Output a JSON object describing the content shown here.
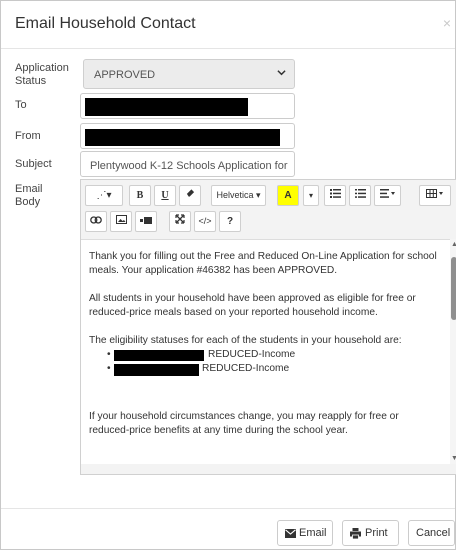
{
  "dialog": {
    "title": "Email Household Contact",
    "close_glyph": "×"
  },
  "form": {
    "status_label": "Application Status",
    "status_label_line1": "Application",
    "status_label_line2": "Status",
    "status_value": "APPROVED",
    "to_label": "To",
    "from_label": "From",
    "subject_label": "Subject",
    "subject_value": "Plentywood K-12 Schools Application for",
    "body_label_line1": "Email",
    "body_label_line2": "Body"
  },
  "toolbar": {
    "row1": {
      "magic_label": "⋰▾",
      "bold_label": "B",
      "underline_label": "U",
      "eraser_label": "⌫",
      "font_label": "Helvetica ▾",
      "color_label": "A",
      "color_caret": "▾",
      "ul_label": "☰",
      "ol_label": "☷",
      "align_label": "≡ ▾",
      "table_label": "⊞ ▾"
    },
    "row2": {
      "link_label": "⊖",
      "image_label": "▣",
      "video_label": "▪▬",
      "fullscreen_label": "✕",
      "code_label": "</>",
      "help_label": "?"
    }
  },
  "body": {
    "para1": "Thank you for filling out the Free and Reduced On-Line Application for school meals. Your application #46382 has been APPROVED.",
    "para2": "All students in your household have been approved as eligible for free or reduced-price meals based on your reported household income.",
    "para3": "The eligibility statuses for each of the students in your household are:",
    "students": [
      {
        "status": "REDUCED-Income"
      },
      {
        "status": "REDUCED-Income"
      }
    ],
    "para4": "If your household circumstances change, you may reapply for free or reduced-price benefits at any time during the school year."
  },
  "footer": {
    "email_label": "Email",
    "print_label": "Print",
    "cancel_label": "Cancel"
  },
  "icons": {
    "email": "envelope-icon",
    "print": "printer-icon"
  }
}
